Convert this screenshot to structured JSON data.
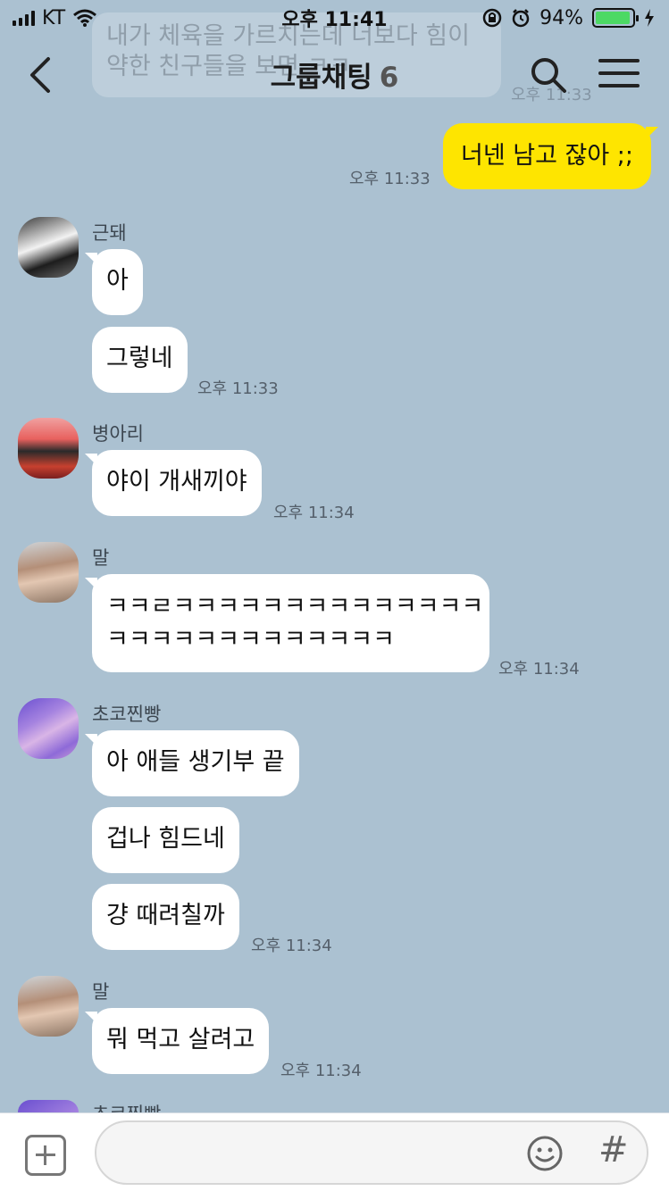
{
  "status_bar": {
    "carrier": "KT",
    "time": "오후 11:41",
    "battery": "94%",
    "battery_level": 0.94
  },
  "header": {
    "title": "그룹채팅",
    "member_count": "6"
  },
  "faded_message": {
    "line1": "내가 체육을 가르치는데 너보다 힘이",
    "line2": "약한 친구들을 보면 ㅋㅋ",
    "time": "오후 11:33"
  },
  "messages": {
    "me": {
      "text": "너넨 남고 잖아 ;;",
      "time": "오후 11:33"
    },
    "g1": {
      "sender": "근돼",
      "bubbles": [
        "아",
        "그렇네"
      ],
      "time": "오후 11:33"
    },
    "g2": {
      "sender": "병아리",
      "bubbles": [
        "야이 개새끼야"
      ],
      "time": "오후 11:34"
    },
    "g3": {
      "sender": "말",
      "line1": "ㅋㅋㄹㅋㅋㅋㅋㅋㅋㅋㅋㅋㅋㅋㅋㅋㅋ",
      "line2": "ㅋㅋㅋㅋㅋㅋㅋㅋㅋㅋㅋㅋㅋ",
      "time": "오후 11:34"
    },
    "g4": {
      "sender": "초코찐빵",
      "bubbles": [
        "아 애들 생기부 끝",
        "겁나 힘드네",
        "걍 때려칠까"
      ],
      "time": "오후 11:34"
    },
    "g5": {
      "sender": "말",
      "bubbles": [
        "뭐 먹고 살려고"
      ],
      "time": "오후 11:34"
    },
    "g6": {
      "sender": "초코찐빵"
    }
  },
  "input": {
    "value": "",
    "placeholder": ""
  },
  "colors": {
    "background": "#abc1d1",
    "my_bubble": "#fee500",
    "other_bubble": "#ffffff"
  }
}
